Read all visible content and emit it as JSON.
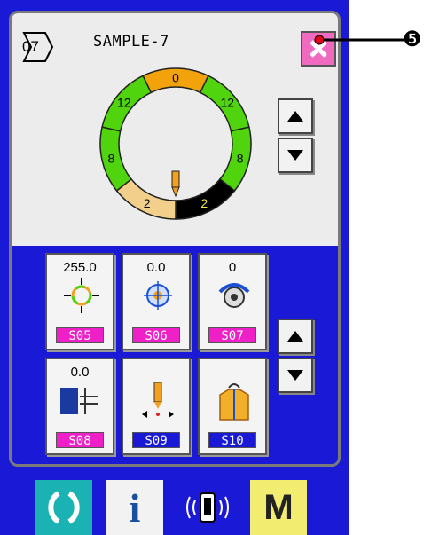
{
  "header": {
    "pattern_number": "07",
    "pattern_name": "SAMPLE-7"
  },
  "ring": {
    "segments": [
      {
        "label": "0",
        "color": "#f2a20a"
      },
      {
        "label": "12",
        "color": "#4fd40e"
      },
      {
        "label": "8",
        "color": "#4fd40e"
      },
      {
        "label": "2",
        "color": "#000000"
      },
      {
        "label": "2",
        "color": "#f2d08c"
      },
      {
        "label": "8",
        "color": "#4fd40e"
      },
      {
        "label": "12",
        "color": "#4fd40e"
      }
    ]
  },
  "tiles": [
    {
      "value": "255.0",
      "code": "S05",
      "code_color": "#f020c8",
      "icon": "sensor-ring-icon"
    },
    {
      "value": "0.0",
      "code": "S06",
      "code_color": "#f020c8",
      "icon": "target-icon"
    },
    {
      "value": "0",
      "code": "S07",
      "code_color": "#f020c8",
      "icon": "dial-icon"
    },
    {
      "value": "0.0",
      "code": "S08",
      "code_color": "#f020c8",
      "icon": "fabric-height-icon"
    },
    {
      "value": "",
      "code": "S09",
      "code_color": "#1a1ad6",
      "icon": "needle-icon"
    },
    {
      "value": "",
      "code": "S10",
      "code_color": "#1a1ad6",
      "icon": "garment-icon"
    }
  ],
  "callout": {
    "label": "❺"
  },
  "bottom_bar": {
    "info_label": "i",
    "mode_label": "M"
  }
}
